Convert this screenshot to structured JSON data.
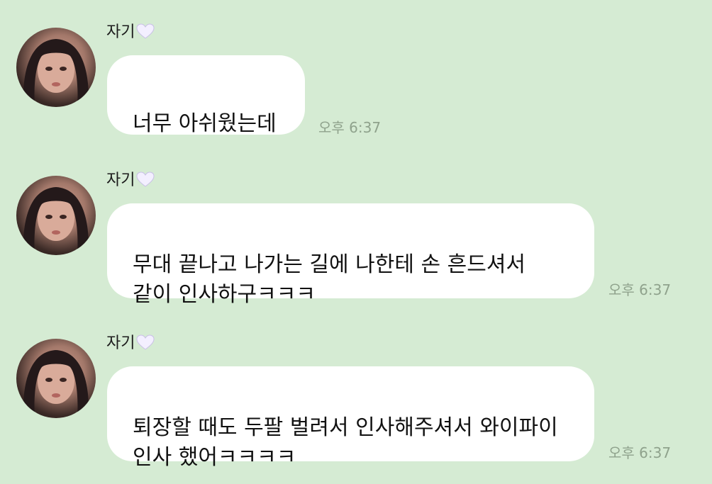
{
  "chat": {
    "messages": [
      {
        "sender": "자기",
        "sender_icon": "white-heart-icon",
        "text": "너무 아쉬웠는데",
        "time": "오후 6:37"
      },
      {
        "sender": "자기",
        "sender_icon": "white-heart-icon",
        "text": "무대 끝나고 나가는 길에 나한테 손 흔드셔서\n같이 인사하구ㅋㅋㅋ",
        "time": "오후 6:37"
      },
      {
        "sender": "자기",
        "sender_icon": "white-heart-icon",
        "text": "퇴장할 때도 두팔 벌려서 인사해주셔서 와이파이\n인사 했어ㅋㅋㅋㅋ",
        "time": "오후 6:37"
      }
    ]
  },
  "colors": {
    "background": "#d5ebd3",
    "bubble": "#ffffff",
    "timestamp": "#8fa28c"
  }
}
